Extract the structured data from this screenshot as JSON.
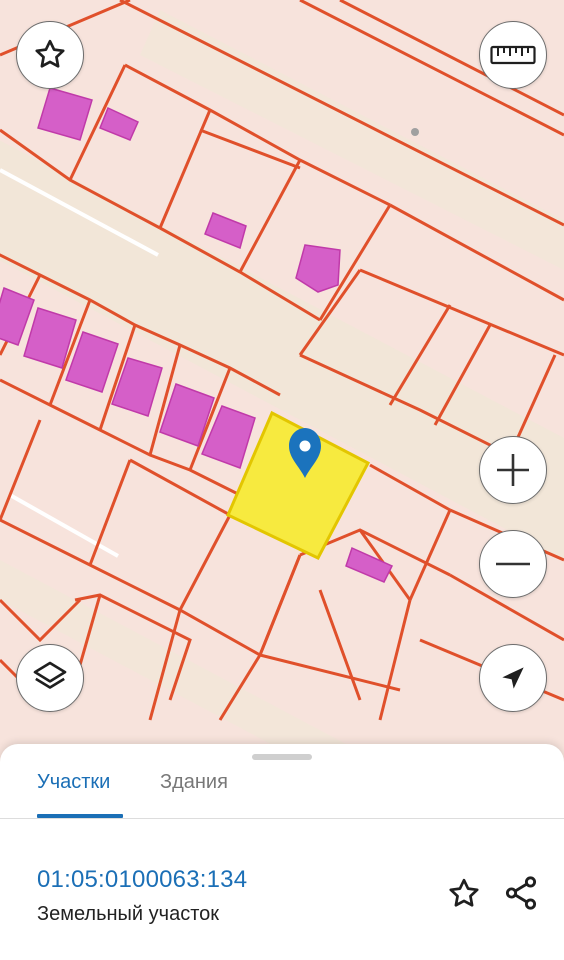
{
  "map": {
    "controls": {
      "favorite_icon": "star-icon",
      "ruler_icon": "ruler-icon",
      "zoom_in_icon": "plus-icon",
      "zoom_out_icon": "minus-icon",
      "layers_icon": "layers-icon",
      "location_icon": "navigation-arrow-icon"
    },
    "colors": {
      "background": "#f7e3dc",
      "parcel_border": "#e0502b",
      "building_fill": "#d55fc8",
      "selected_parcel": "#f7ea3f",
      "road": "#f0e3d5",
      "pin": "#1b73bd"
    }
  },
  "sheet": {
    "tabs": [
      {
        "label": "Участки",
        "active": true
      },
      {
        "label": "Здания",
        "active": false
      }
    ],
    "result": {
      "cadastral_number": "01:05:0100063:134",
      "type": "Земельный участок",
      "favorite_icon": "star-outline-icon",
      "share_icon": "share-icon"
    },
    "accent_color": "#1b6fb6"
  }
}
